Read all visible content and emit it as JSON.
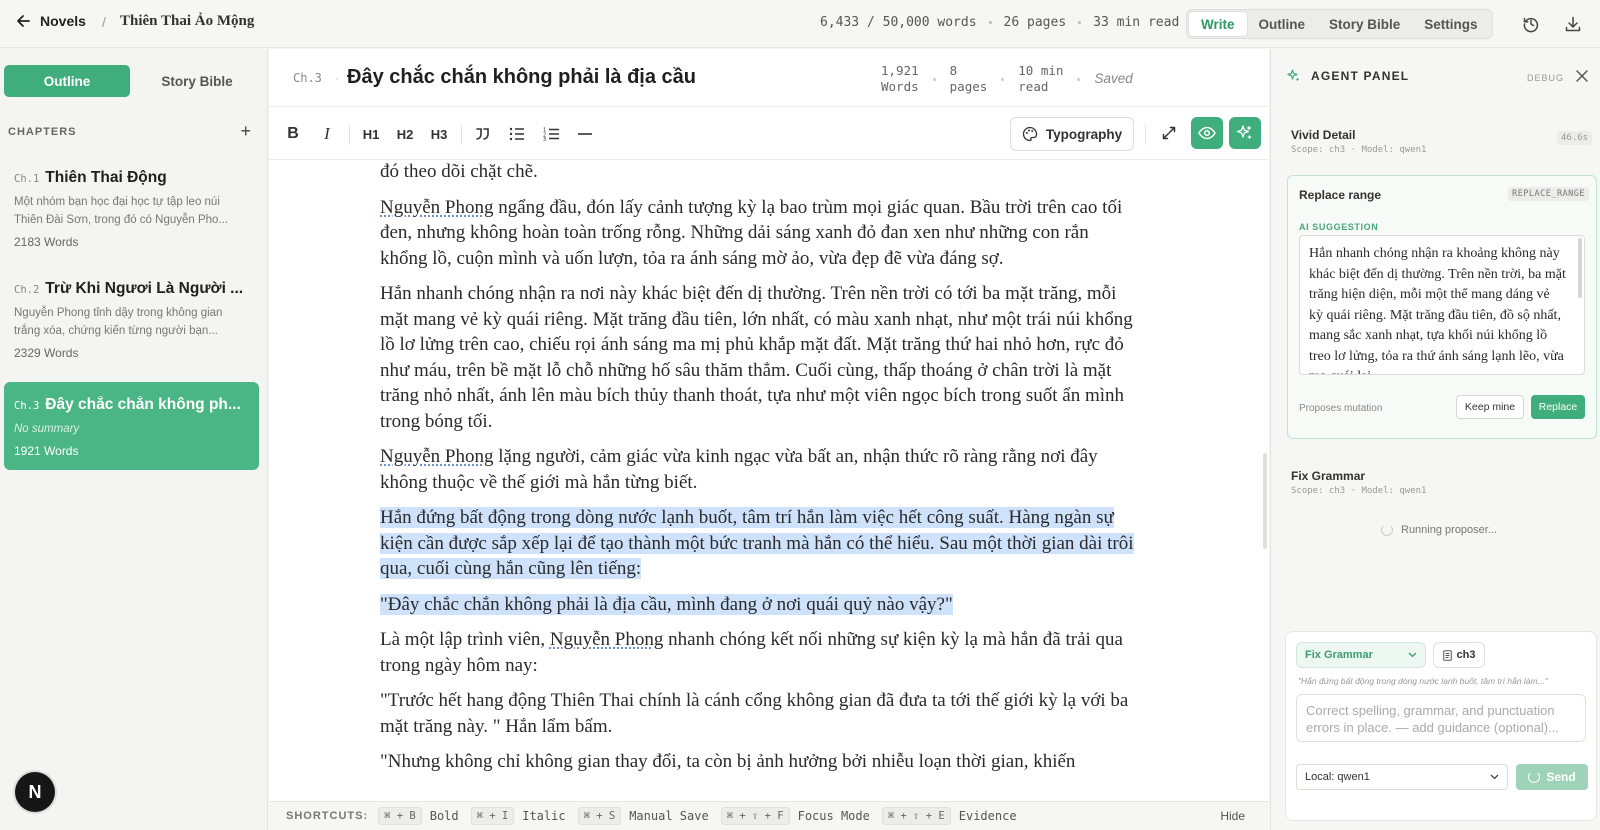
{
  "topbar": {
    "back_label": "Novels",
    "separator": "/",
    "book_title": "Thiên Thai Ảo Mộng",
    "words_stat": "6,433 / 50,000 words",
    "pages_stat": "26 pages",
    "read_stat": "33 min read",
    "tabs": [
      "Write",
      "Outline",
      "Story Bible",
      "Settings"
    ],
    "active_tab": "Write",
    "icons": [
      "history-icon",
      "download-icon"
    ]
  },
  "sidebar": {
    "tabs": [
      "Outline",
      "Story Bible"
    ],
    "chapters_label": "CHAPTERS",
    "add_label": "+",
    "chapters": [
      {
        "num": "Ch.1",
        "title": "Thiên Thai Động",
        "summary": "Một nhóm bạn học đại học tự tập leo núi Thiên Đài Sơn, trong đó có Nguyễn Pho...",
        "words": "2183 Words"
      },
      {
        "num": "Ch.2",
        "title": "Trừ Khi Ngươi Là Người ...",
        "summary": "Nguyễn Phong tỉnh dậy trong không gian trắng xóa, chứng kiến từng người bạn...",
        "words": "2329 Words"
      },
      {
        "num": "Ch.3",
        "title": "Đây chắc chắn không ph...",
        "summary": "No summary",
        "words": "1921 Words"
      }
    ],
    "avatar_letter": "N"
  },
  "chapter_header": {
    "num": "Ch.3",
    "dot": "·",
    "title": "Đây chắc chắn không phải là địa cầu",
    "words_value": "1,921",
    "words_label": "Words",
    "pages_value": "8",
    "pages_label": "pages",
    "read_value": "10 min",
    "read_label": "read",
    "saved": "Saved"
  },
  "toolbar": {
    "bold": "B",
    "italic": "I",
    "h1": "H1",
    "h2": "H2",
    "h3": "H3",
    "typography_label": "Typography"
  },
  "document": {
    "p0": "đó theo dõi chặt chẽ.",
    "p1_name": "Nguyễn Phong",
    "p1_rest": " ngẩng đầu, đón lấy cảnh tượng kỳ lạ bao trùm mọi giác quan. Bầu trời trên cao tối đen, nhưng không hoàn toàn trống rỗng. Những dải sáng xanh đỏ đan xen như những con rắn khổng lồ, cuộn mình và uốn lượn, tỏa ra ánh sáng mờ ảo, vừa đẹp đẽ vừa đáng sợ.",
    "p2": "Hắn nhanh chóng nhận ra nơi này khác biệt đến dị thường. Trên nền trời có tới ba mặt trăng, mỗi mặt mang vẻ kỳ quái riêng. Mặt trăng đầu tiên, lớn nhất, có màu xanh nhạt, như một trái núi khổng lồ lơ lửng trên cao, chiếu rọi ánh sáng ma mị phủ khắp mặt đất. Mặt trăng thứ hai nhỏ hơn, rực đỏ như máu, trên bề mặt lỗ chỗ những hố sâu thăm thẳm. Cuối cùng, thấp thoáng ở chân trời là mặt trăng nhỏ nhất, ánh lên màu bích thủy thanh thoát, tựa như một viên ngọc bích trong suốt ẩn mình trong bóng tối.",
    "p3_name": "Nguyễn Phong",
    "p3_rest": " lặng người, cảm giác vừa kinh ngạc vừa bất an, nhận thức rõ ràng rằng nơi đây không thuộc về thế giới mà hắn từng biết.",
    "p4": "Hắn đứng bất động trong dòng nước lạnh buốt, tâm trí hắn làm việc hết công suất. Hàng ngàn sự kiện cần được sắp xếp lại để tạo thành một bức tranh mà hắn có thể hiểu. Sau một thời gian dài trôi qua, cuối cùng hắn cũng lên tiếng:",
    "p5": "\"Đây chắc chắn không phải là địa cầu, mình đang ở nơi quái quỷ nào vậy?\"",
    "p6_a": "Là một lập trình viên, ",
    "p6_name": "Nguyễn Phong",
    "p6_b": " nhanh chóng kết nối những sự kiện kỳ lạ mà hắn đã trải qua trong ngày hôm nay:",
    "p7": "\"Trước hết hang động Thiên Thai chính là cánh cổng không gian đã đưa ta tới thế giới kỳ lạ với ba mặt trăng này. \" Hắn lẩm bẩm.",
    "p8": "\"Nhưng không chỉ không gian thay đổi, ta còn bị ảnh hưởng bởi nhiễu loạn thời gian, khiến"
  },
  "shortcuts": {
    "label": "SHORTCUTS:",
    "items": [
      {
        "key": "⌘ + B",
        "action": "Bold"
      },
      {
        "key": "⌘ + I",
        "action": "Italic"
      },
      {
        "key": "⌘ + S",
        "action": "Manual Save"
      },
      {
        "key": "⌘ + ⇧ + F",
        "action": "Focus Mode"
      },
      {
        "key": "⌘ + ⇧ + E",
        "action": "Evidence"
      }
    ],
    "hide_label": "Hide"
  },
  "agent_panel": {
    "title": "AGENT PANEL",
    "debug": "DEBUG",
    "job1": {
      "name": "Vivid Detail",
      "meta": "Scope: ch3 · Model: qwen1",
      "time": "46.6s"
    },
    "card": {
      "title": "Replace range",
      "tag": "REPLACE_RANGE",
      "suggestion_label": "AI SUGGESTION",
      "suggestion_text": "Hắn nhanh chóng nhận ra khoảng không này khác biệt đến dị thường. Trên nền trời, ba mặt trăng hiện diện, mỗi một thể mang dáng vẻ kỳ quái riêng. Mặt trăng đầu tiên, đồ sộ nhất, mang sắc xanh nhạt, tựa khối núi khổng lồ treo lơ lửng, tỏa ra thứ ánh sáng lạnh lẽo, vừa ma quái lại...",
      "proposes": "Proposes mutation",
      "keep_label": "Keep mine",
      "replace_label": "Replace"
    },
    "job2": {
      "name": "Fix Grammar",
      "meta": "Scope: ch3 · Model: qwen1"
    },
    "running": "Running proposer...",
    "composer": {
      "mode": "Fix Grammar",
      "scope": "ch3",
      "quote": "\"Hắn đứng bất động trong dòng nước lạnh buốt, tâm trí hắn làm...\"",
      "placeholder": "Correct spelling, grammar, and punctuation errors in place. — add guidance (optional)...",
      "model": "Local: qwen1",
      "send_label": "Send"
    }
  },
  "colors": {
    "accent": "#3fad7c",
    "highlight": "#cfe2fb",
    "background": "#f6f6f4"
  }
}
